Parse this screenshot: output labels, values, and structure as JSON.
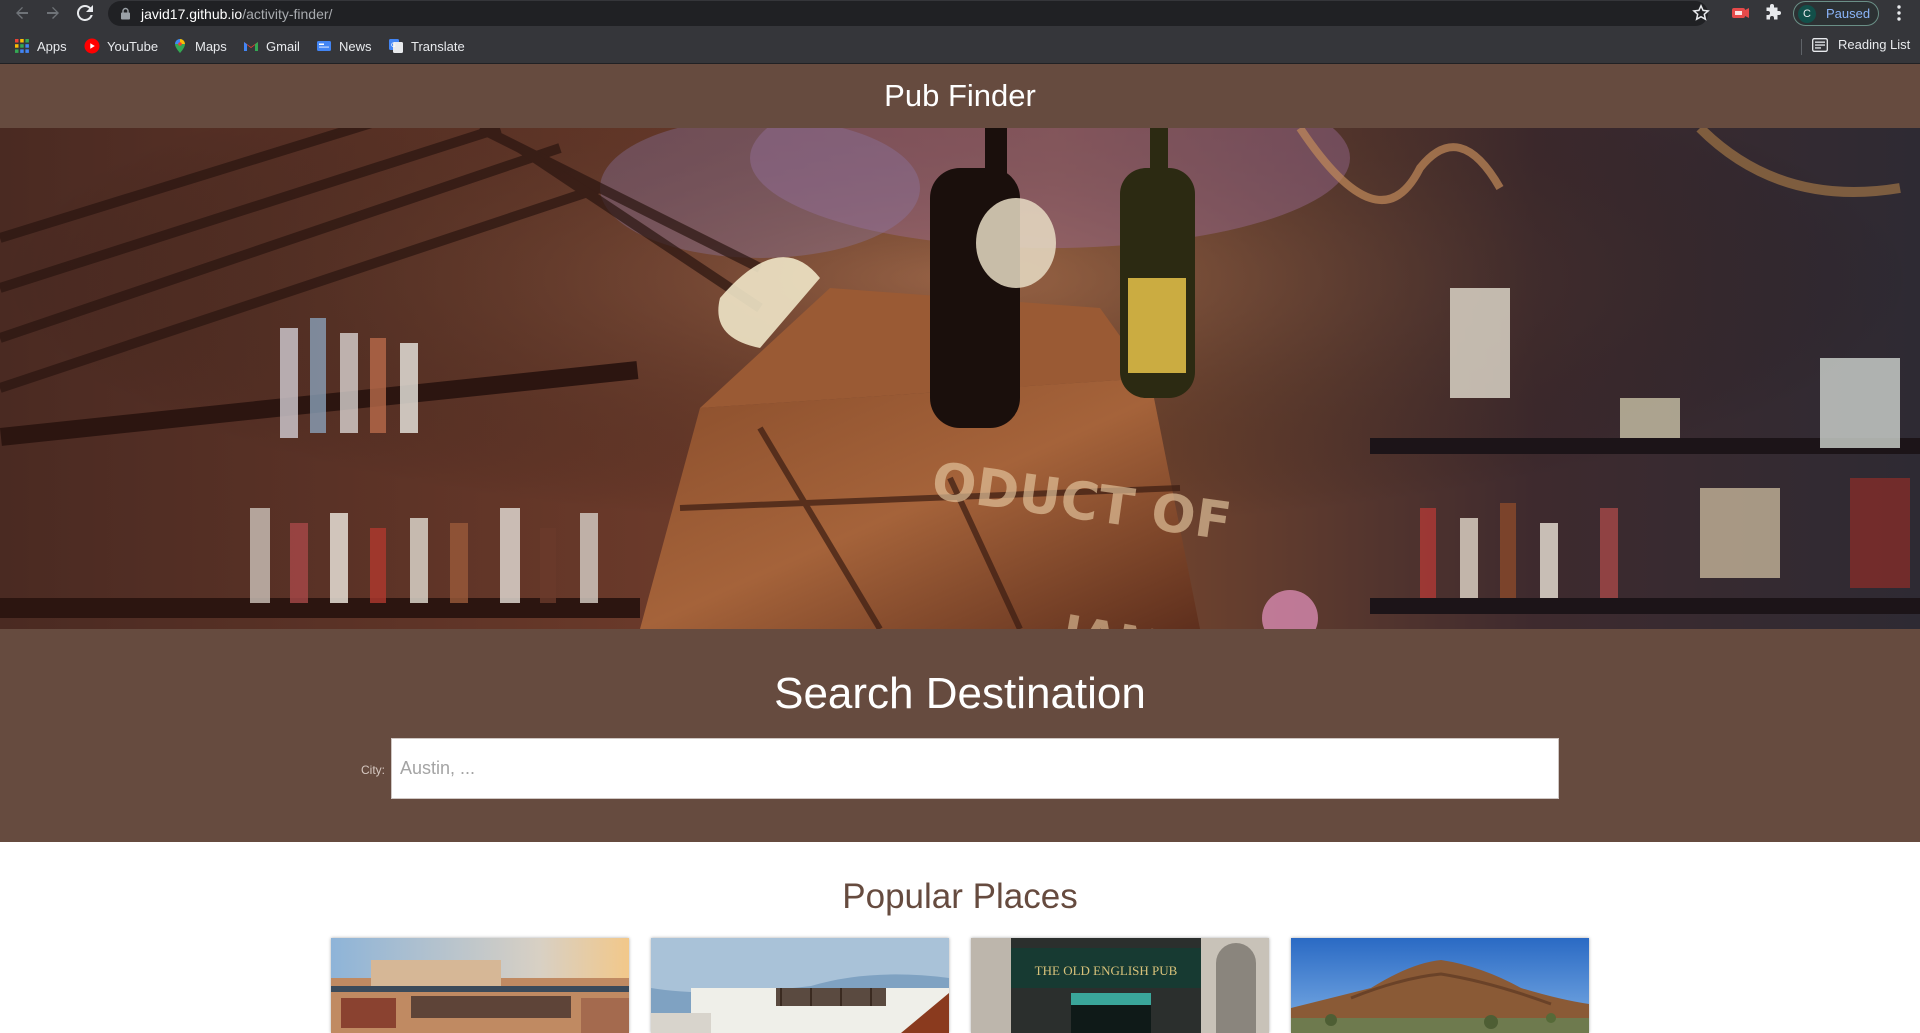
{
  "browser": {
    "url_host": "javid17.github.io",
    "url_path": "/activity-finder/",
    "profile_initial": "C",
    "profile_status": "Paused",
    "bookmarks": [
      {
        "label": "Apps",
        "icon": "apps-grid-icon"
      },
      {
        "label": "YouTube",
        "icon": "youtube-icon"
      },
      {
        "label": "Maps",
        "icon": "maps-icon"
      },
      {
        "label": "Gmail",
        "icon": "gmail-icon"
      },
      {
        "label": "News",
        "icon": "news-icon"
      },
      {
        "label": "Translate",
        "icon": "translate-icon"
      }
    ],
    "reading_list": "Reading List"
  },
  "header": {
    "title": "Pub Finder",
    "background_color": "#664b3f"
  },
  "hero": {
    "image": "pub-bar-shelves-photo"
  },
  "search": {
    "heading": "Search Destination",
    "city_label": "City:",
    "city_placeholder": "Austin, ...",
    "city_value": ""
  },
  "popular": {
    "heading": "Popular Places",
    "cards": [
      {
        "image": "austin-rooftop-restaurant-photo"
      },
      {
        "image": "white-building-rooftop-deck-photo"
      },
      {
        "image": "the-old-english-pub-storefront-photo",
        "sign_text": "THE OLD ENGLISH PUB"
      },
      {
        "image": "desert-mountain-landscape-photo"
      }
    ]
  }
}
